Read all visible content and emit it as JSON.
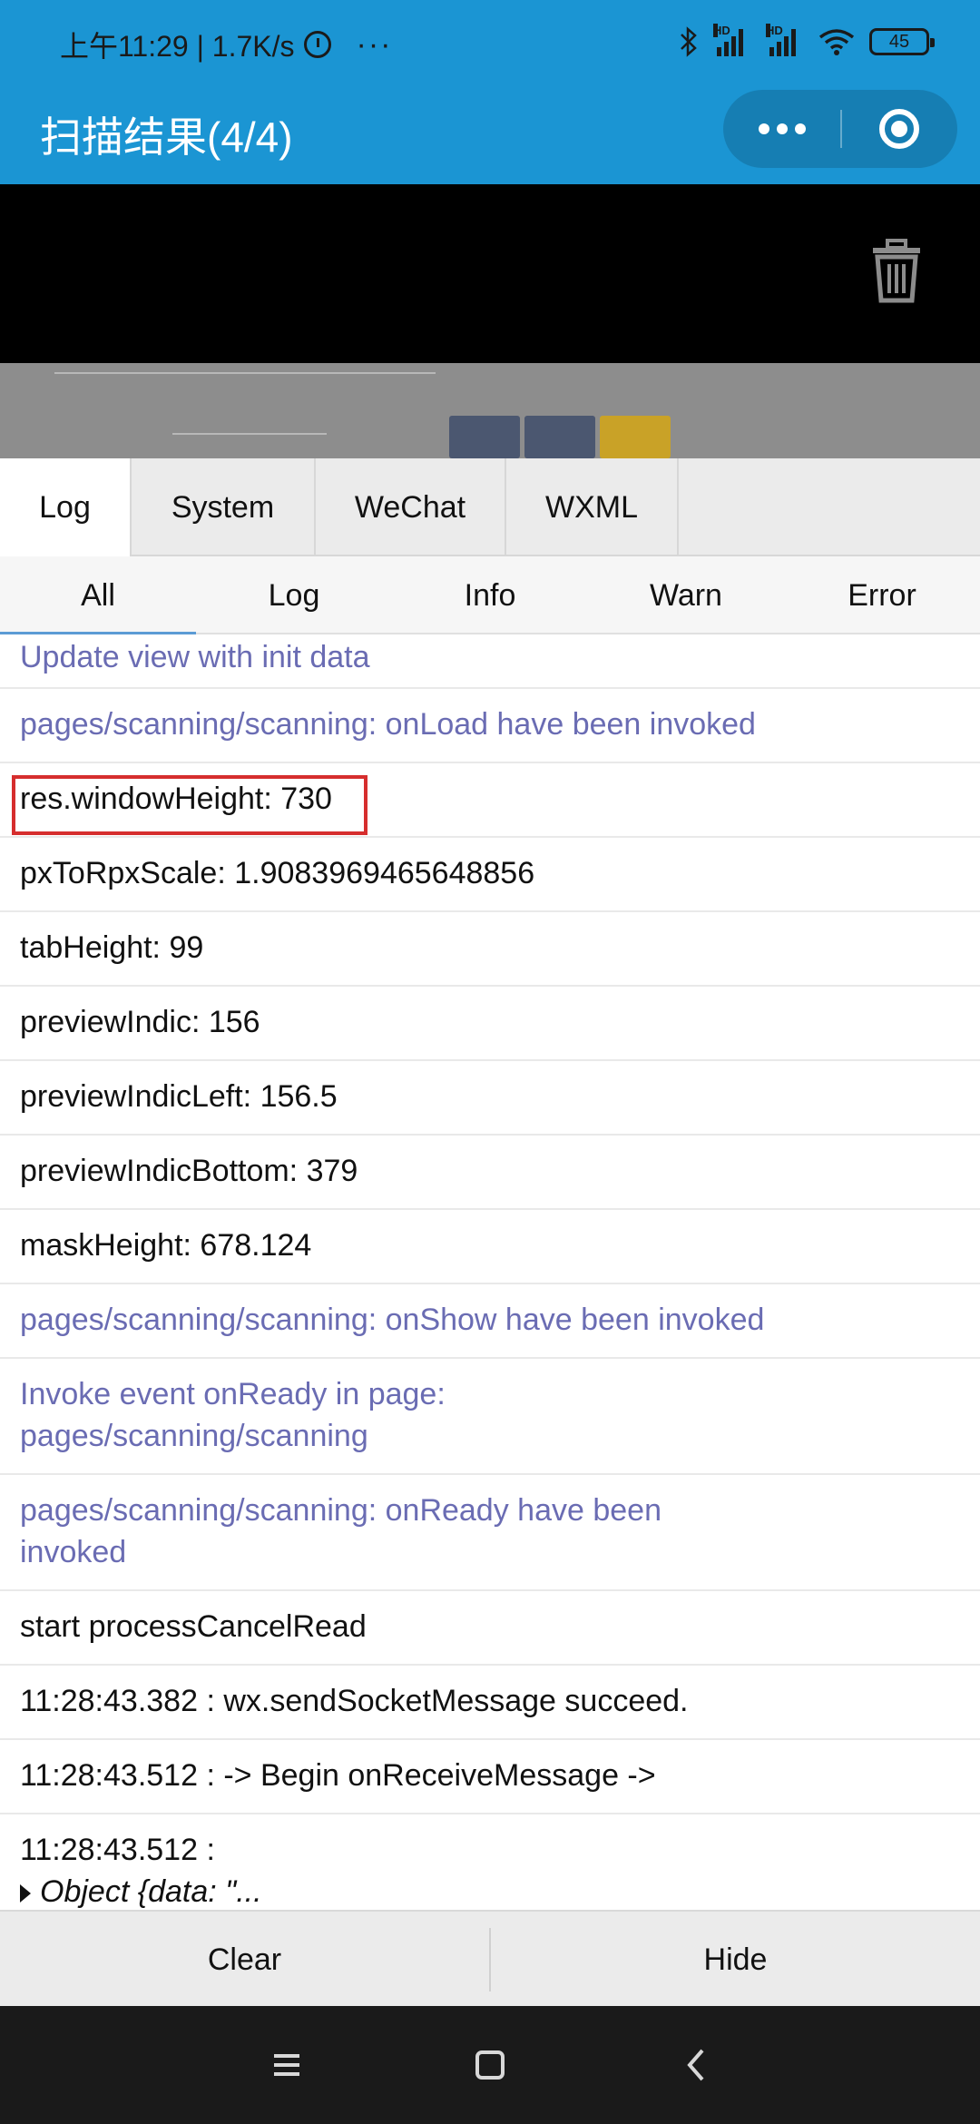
{
  "status_bar": {
    "time_speed": "上午11:29 | 1.7K/s",
    "battery": "45",
    "hd_label": "HD"
  },
  "nav": {
    "title": "扫描结果(4/4)"
  },
  "preview": {
    "card_colors": [
      "#4b5770",
      "#4b5770",
      "#c9a227"
    ]
  },
  "tabs": [
    "Log",
    "System",
    "WeChat",
    "WXML"
  ],
  "filters": [
    "All",
    "Log",
    "Info",
    "Warn",
    "Error"
  ],
  "logs": [
    {
      "text": "Update view with init data",
      "type": "info"
    },
    {
      "text": "pages/scanning/scanning: onLoad have been invoked",
      "type": "info"
    },
    {
      "text": "res.windowHeight: 730",
      "type": "log"
    },
    {
      "text": "pxToRpxScale: 1.9083969465648856",
      "type": "log"
    },
    {
      "text": "tabHeight: 99",
      "type": "log"
    },
    {
      "text": "previewIndic: 156",
      "type": "log"
    },
    {
      "text": "previewIndicLeft: 156.5",
      "type": "log"
    },
    {
      "text": "previewIndicBottom: 379",
      "type": "log"
    },
    {
      "text": "maskHeight: 678.124",
      "type": "log"
    },
    {
      "text": "pages/scanning/scanning: onShow have been invoked",
      "type": "info"
    },
    {
      "text": "Invoke event onReady in page: pages/scanning/scanning",
      "type": "info"
    },
    {
      "text": "pages/scanning/scanning: onReady have been invoked",
      "type": "info"
    },
    {
      "text": "start processCancelRead",
      "type": "log"
    },
    {
      "text": "11:28:43.382 : wx.sendSocketMessage succeed.",
      "type": "log"
    },
    {
      "text": "11:28:43.512 : -> Begin onReceiveMessage ->",
      "type": "log"
    },
    {
      "text": "11:28:43.512 :",
      "type": "log",
      "object": "Object {data: \"..."
    }
  ],
  "bottom": {
    "clear": "Clear",
    "hide": "Hide"
  },
  "colors": {
    "brand_blue": "#1b95d3",
    "info_text": "#6a6cb3",
    "highlight_border": "#d62e2e"
  },
  "icons": [
    "bluetooth-icon",
    "signal-icon",
    "wifi-icon",
    "battery-icon",
    "alarm-icon",
    "more-icon",
    "close-mini-program-icon",
    "trash-icon",
    "menu-icon",
    "home-icon",
    "back-icon"
  ]
}
